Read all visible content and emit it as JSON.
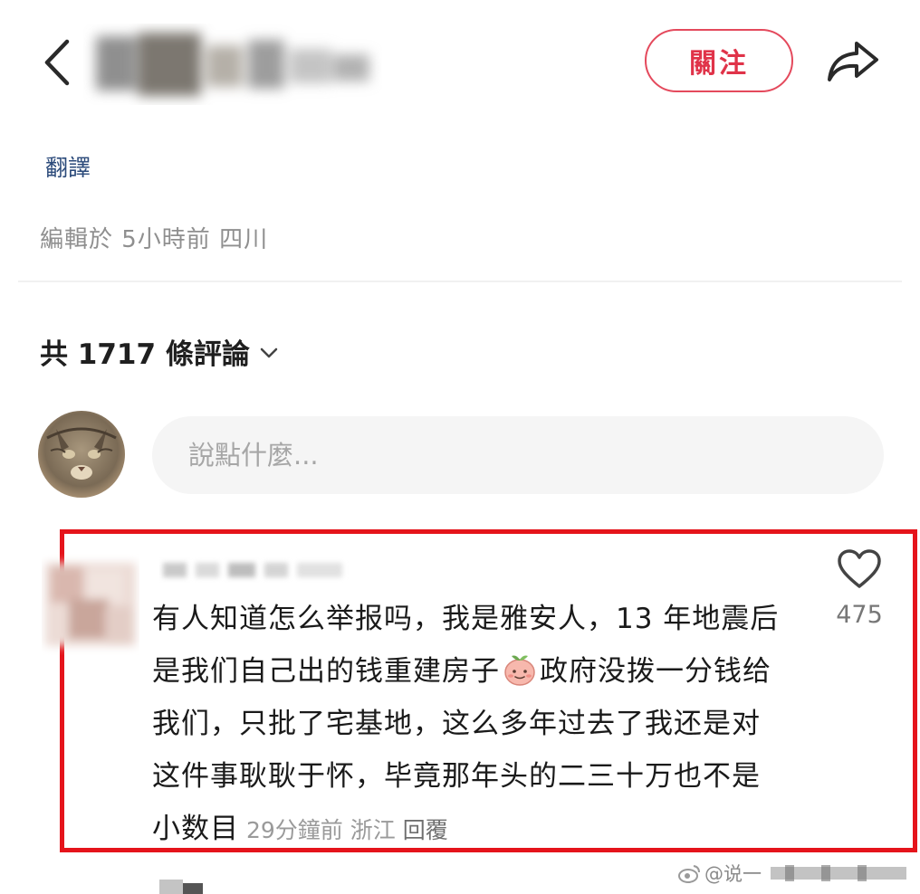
{
  "header": {
    "follow_label": "關注"
  },
  "post": {
    "translate_label": "翻譯",
    "edit_info": "編輯於 5小時前 四川"
  },
  "comments": {
    "count_label": "共 1717 條評論",
    "input_placeholder": "說點什麼..."
  },
  "highlighted_comment": {
    "text_part1": "有人知道怎么举报吗，我是雅安人，13 年地震后是我们自己出的钱重建房子",
    "text_part2": "政府没拨一分钱给我们，只批了宅基地，这么多年过去了我还是对这件事耿耿于怀，毕竟那年头的二三十万也不是小数目",
    "time": "29分鐘前",
    "location": "浙江",
    "reply_label": "回覆",
    "likes": "475"
  },
  "watermark": {
    "text": "@说一"
  },
  "colors": {
    "accent": "#e03349",
    "highlight_border": "#e5141b",
    "link_blue": "#2b4a7a",
    "muted_text": "#8f8f8f"
  }
}
